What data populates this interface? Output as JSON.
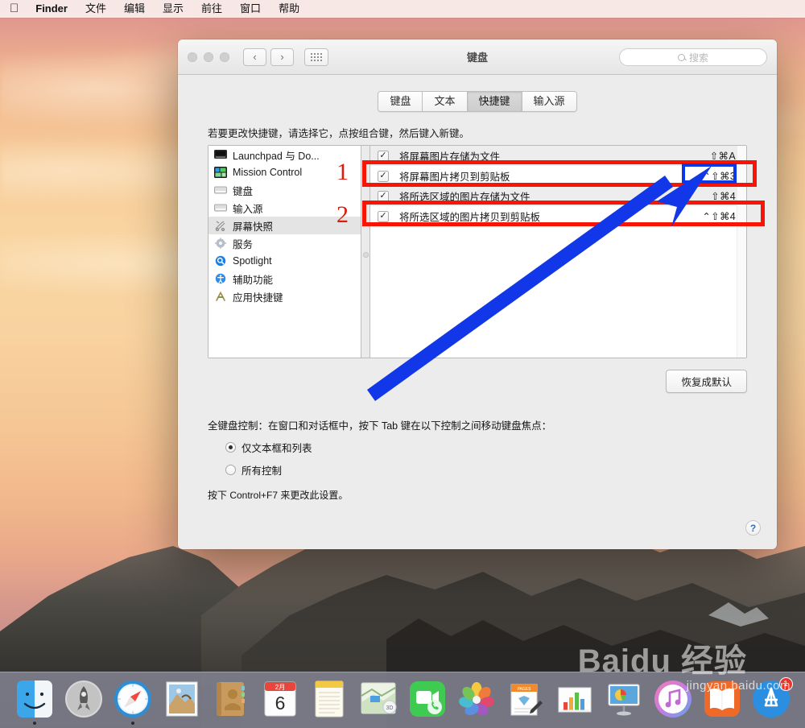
{
  "menubar": {
    "apple": "apple-logo",
    "items": [
      "Finder",
      "文件",
      "编辑",
      "显示",
      "前往",
      "窗口",
      "帮助"
    ]
  },
  "window": {
    "title": "键盘",
    "search_placeholder": "搜索",
    "nav_back": "‹",
    "nav_forward": "›",
    "help_label": "?"
  },
  "tabs": [
    {
      "label": "键盘",
      "active": false
    },
    {
      "label": "文本",
      "active": false
    },
    {
      "label": "快捷键",
      "active": true
    },
    {
      "label": "输入源",
      "active": false
    }
  ],
  "hint": "若要更改快捷键，请选择它，点按组合键，然后键入新键。",
  "categories": [
    {
      "label": "Launchpad 与 Do...",
      "icon": "launchpad-dock-icon",
      "selected": false
    },
    {
      "label": "Mission Control",
      "icon": "mission-control-icon",
      "selected": false
    },
    {
      "label": "键盘",
      "icon": "keyboard-icon",
      "selected": false
    },
    {
      "label": "输入源",
      "icon": "input-source-icon",
      "selected": false
    },
    {
      "label": "屏幕快照",
      "icon": "screenshot-icon",
      "selected": true
    },
    {
      "label": "服务",
      "icon": "services-gear-icon",
      "selected": false
    },
    {
      "label": "Spotlight",
      "icon": "spotlight-search-icon",
      "selected": false
    },
    {
      "label": "辅助功能",
      "icon": "accessibility-icon",
      "selected": false
    },
    {
      "label": "应用快捷键",
      "icon": "app-shortcuts-icon",
      "selected": false
    }
  ],
  "shortcuts": [
    {
      "checked": true,
      "name": "将屏幕图片存储为文件",
      "key": "⇧⌘A"
    },
    {
      "checked": true,
      "name": "将屏幕图片拷贝到剪贴板",
      "key": "⌃⇧⌘3"
    },
    {
      "checked": true,
      "name": "将所选区域的图片存储为文件",
      "key": "⇧⌘4"
    },
    {
      "checked": true,
      "name": "将所选区域的图片拷贝到剪贴板",
      "key": "⌃⇧⌘4"
    }
  ],
  "restore_button": "恢复成默认",
  "full_keyboard": {
    "label": "全键盘控制：在窗口和对话框中，按下 Tab 键在以下控制之间移动键盘焦点：",
    "options": [
      {
        "label": "仅文本框和列表",
        "selected": true
      },
      {
        "label": "所有控制",
        "selected": false
      }
    ],
    "note": "按下 Control+F7 来更改此设置。"
  },
  "annotations": {
    "red_color": "#f71606",
    "blue_color": "#0b39e8",
    "number_color": "#e01a0d",
    "marks": [
      {
        "text": "1",
        "target": "将屏幕图片存储为文件"
      },
      {
        "text": "2",
        "target": "将所选区域的图片存储为文件"
      }
    ],
    "arrow": "blue-arrow-pointing-to-shortcut",
    "blue_highlight": "⇧⌘A"
  },
  "dock": {
    "items": [
      {
        "name": "finder-icon",
        "running": true
      },
      {
        "name": "launchpad-icon",
        "running": false
      },
      {
        "name": "safari-icon",
        "running": true
      },
      {
        "name": "mail-icon",
        "running": false
      },
      {
        "name": "contacts-icon",
        "running": false
      },
      {
        "name": "calendar-icon",
        "running": false,
        "month": "2月",
        "day": "6"
      },
      {
        "name": "notes-icon",
        "running": false
      },
      {
        "name": "maps-icon",
        "running": false
      },
      {
        "name": "facetime-icon",
        "running": false
      },
      {
        "name": "photos-icon",
        "running": false
      },
      {
        "name": "pages-icon",
        "running": false
      },
      {
        "name": "numbers-icon",
        "running": false
      },
      {
        "name": "keynote-icon",
        "running": false
      },
      {
        "name": "itunes-icon",
        "running": false
      },
      {
        "name": "ibooks-icon",
        "running": false
      },
      {
        "name": "appstore-icon",
        "running": false,
        "badge": "1"
      }
    ]
  },
  "watermark": {
    "brand": "Baidu 经验",
    "url": "jingyan.baidu.com"
  }
}
